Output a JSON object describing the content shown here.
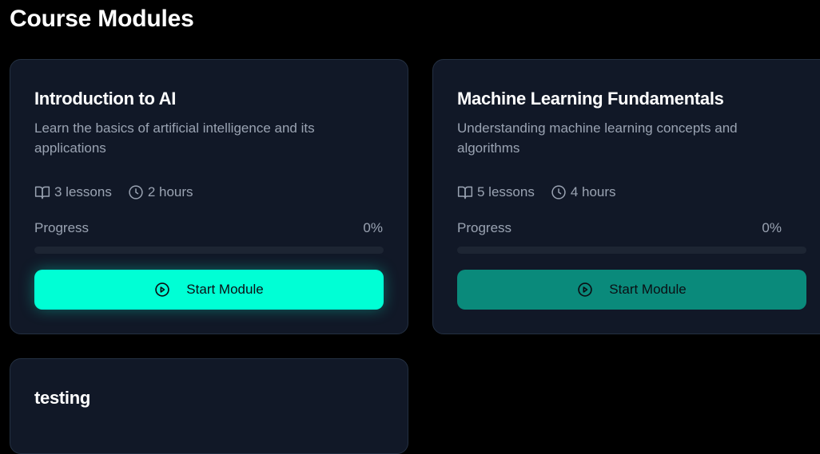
{
  "page": {
    "title": "Course Modules"
  },
  "colors": {
    "background": "#000000",
    "card_background": "#111827",
    "card_border": "#243042",
    "accent": "#00ffd5",
    "accent_muted": "#0a8a7b",
    "muted_text": "#9aa3b2"
  },
  "modules": [
    {
      "title": "Introduction to AI",
      "description": "Learn the basics of artificial intelligence and its applications",
      "lessons": "3 lessons",
      "duration": "2 hours",
      "progress_label": "Progress",
      "progress_text": "0%",
      "progress_fraction": 0,
      "button_label": "Start Module",
      "lessons_icon": "book-open-icon",
      "duration_icon": "clock-icon",
      "button_icon": "play-circle-icon"
    },
    {
      "title": "Machine Learning Fundamentals",
      "description": "Understanding machine learning concepts and algorithms",
      "lessons": "5 lessons",
      "duration": "4 hours",
      "progress_label": "Progress",
      "progress_text": "0%",
      "progress_fraction": 0,
      "button_label": "Start Module",
      "lessons_icon": "book-open-icon",
      "duration_icon": "clock-icon",
      "button_icon": "play-circle-icon"
    },
    {
      "title": "testing"
    }
  ]
}
